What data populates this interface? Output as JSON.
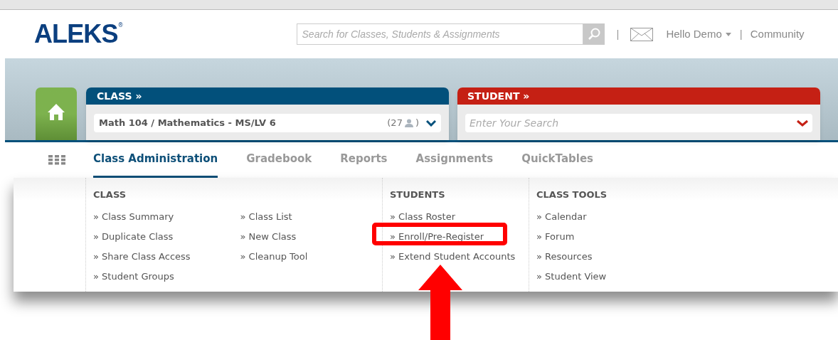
{
  "header": {
    "logo": "ALEKS",
    "logo_mark": "®",
    "search": {
      "placeholder": "Search for Classes, Students & Assignments"
    },
    "separator_1": "|",
    "user_menu": "Hello Demo",
    "separator_2": "|",
    "community": "Community"
  },
  "class_panel": {
    "title": "CLASS »",
    "value": "Math 104 / Mathematics - MS/LV 6",
    "count": "(27",
    "count_end": ")"
  },
  "student_panel": {
    "title": "STUDENT »",
    "placeholder": "Enter Your Search"
  },
  "tabs": [
    {
      "label": "Class Administration",
      "selected": true
    },
    {
      "label": "Gradebook",
      "selected": false
    },
    {
      "label": "Reports",
      "selected": false
    },
    {
      "label": "Assignments",
      "selected": false
    },
    {
      "label": "QuickTables",
      "selected": false
    }
  ],
  "menu": [
    {
      "heading": "CLASS",
      "columns": [
        [
          {
            "label": "» Class Summary",
            "highlighted": false
          },
          {
            "label": "» Duplicate Class",
            "highlighted": false
          },
          {
            "label": "» Share Class Access",
            "highlighted": false
          },
          {
            "label": "» Student Groups",
            "highlighted": false
          }
        ],
        [
          {
            "label": "» Class List",
            "highlighted": false
          },
          {
            "label": "» New Class",
            "highlighted": false
          },
          {
            "label": "» Cleanup Tool",
            "highlighted": false
          }
        ]
      ]
    },
    {
      "heading": "STUDENTS",
      "columns": [
        [
          {
            "label": "» Class Roster",
            "highlighted": false
          },
          {
            "label": "» Enroll/Pre-Register",
            "highlighted": true
          },
          {
            "label": "» Extend Student Accounts",
            "highlighted": false
          }
        ]
      ]
    },
    {
      "heading": "CLASS TOOLS",
      "columns": [
        [
          {
            "label": "» Calendar",
            "highlighted": false
          },
          {
            "label": "» Forum",
            "highlighted": false
          },
          {
            "label": "» Resources",
            "highlighted": false
          },
          {
            "label": "» Student View",
            "highlighted": false
          }
        ]
      ]
    }
  ]
}
